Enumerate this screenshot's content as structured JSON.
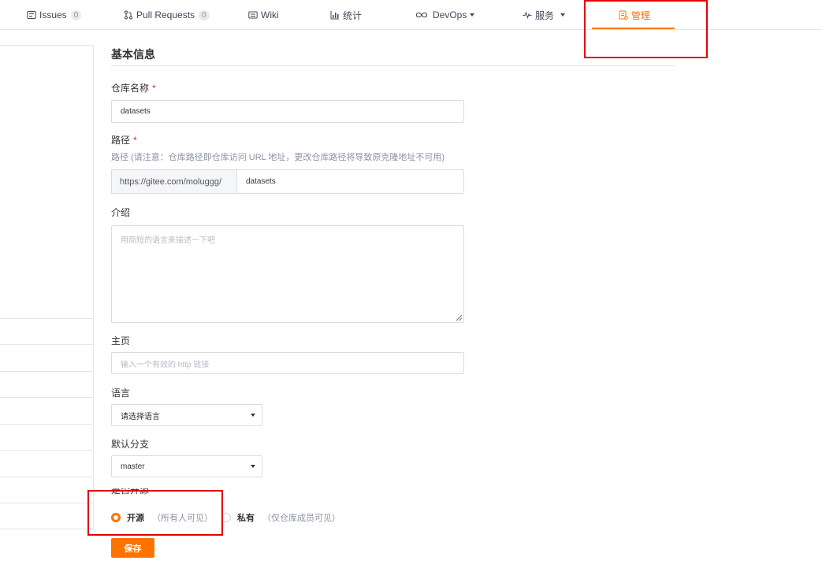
{
  "nav": {
    "issues": {
      "label": "Issues",
      "count": "0"
    },
    "pulls": {
      "label": "Pull Requests",
      "count": "0"
    },
    "wiki": {
      "label": "Wiki"
    },
    "stats": {
      "label": "统计"
    },
    "devops": {
      "label": "DevOps"
    },
    "services": {
      "label": "服务"
    },
    "manage": {
      "label": "管理"
    },
    "active_color": "#fe7300"
  },
  "form": {
    "section_title": "基本信息",
    "repo_name": {
      "label": "仓库名称",
      "required_mark": "*",
      "value": "datasets"
    },
    "path": {
      "label": "路径",
      "required_mark": "*",
      "hint": "路径 (请注意：仓库路径即仓库访问 URL 地址，更改仓库路径将导致原克隆地址不可用)",
      "prefix": "https://gitee.com/moluggg/",
      "value": "datasets"
    },
    "intro": {
      "label": "介绍",
      "placeholder": "用简短的语言来描述一下吧"
    },
    "homepage": {
      "label": "主页",
      "placeholder": "输入一个有效的 http 链接"
    },
    "language": {
      "label": "语言",
      "selected": "请选择语言"
    },
    "default_branch": {
      "label": "默认分支",
      "selected": "master"
    },
    "visibility": {
      "label": "是否开源",
      "options": [
        {
          "label": "开源",
          "desc": "（所有人可见）",
          "checked": true
        },
        {
          "label": "私有",
          "desc": "（仅仓库成员可见）",
          "checked": false
        }
      ]
    },
    "save_label": "保存"
  },
  "colors": {
    "accent": "#fe7300",
    "highlight": "#e30000"
  }
}
